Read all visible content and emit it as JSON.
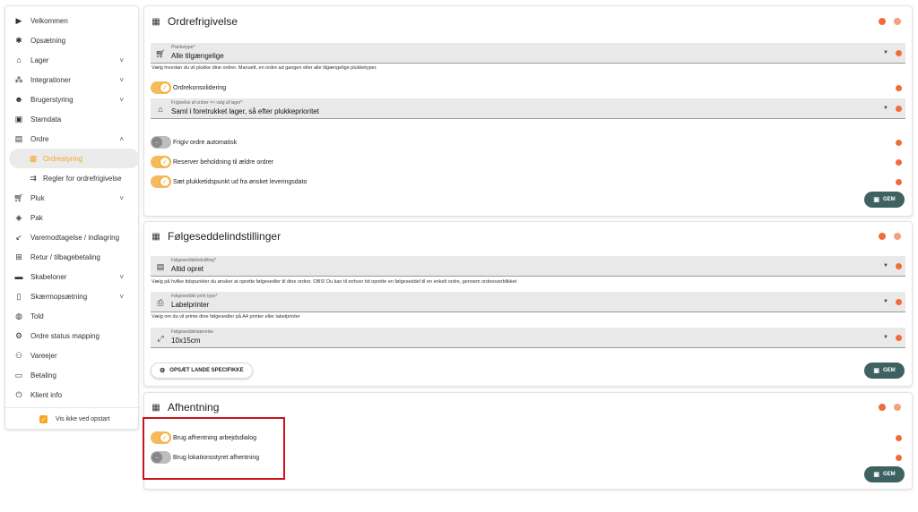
{
  "sidebar": {
    "items": [
      {
        "label": "Velkommen",
        "icon": "play-icon"
      },
      {
        "label": "Opsætning",
        "icon": "gears-icon"
      },
      {
        "label": "Lager",
        "icon": "warehouse-icon",
        "expand": "˅"
      },
      {
        "label": "Integrationer",
        "icon": "hub-icon",
        "expand": "˅"
      },
      {
        "label": "Brugerstyring",
        "icon": "users-icon",
        "expand": "˅"
      },
      {
        "label": "Stamdata",
        "icon": "data-icon"
      },
      {
        "label": "Ordre",
        "icon": "order-icon",
        "expand": "˄"
      },
      {
        "label": "Ordrestyring",
        "icon": "order-control-icon",
        "active": true
      },
      {
        "label": "Regler for ordrefrigivelse",
        "icon": "rules-icon"
      },
      {
        "label": "Pluk",
        "icon": "cart-icon",
        "expand": "˅"
      },
      {
        "label": "Pak",
        "icon": "package-icon"
      },
      {
        "label": "Varemodtagelse / indlagring",
        "icon": "arrow-in-icon"
      },
      {
        "label": "Retur / tilbagebetaling",
        "icon": "return-icon"
      },
      {
        "label": "Skabeloner",
        "icon": "template-icon",
        "expand": "˅"
      },
      {
        "label": "Skærmopsætning",
        "icon": "phone-icon",
        "expand": "˅"
      },
      {
        "label": "Told",
        "icon": "globe-icon"
      },
      {
        "label": "Ordre status mapping",
        "icon": "gear-icon"
      },
      {
        "label": "Vareejer",
        "icon": "owners-icon"
      },
      {
        "label": "Betaling",
        "icon": "payment-icon"
      },
      {
        "label": "Klient info",
        "icon": "power-icon"
      }
    ],
    "footer_label": "Vis ikke ved opstart"
  },
  "panels": {
    "release": {
      "title": "Ordrefrigivelse",
      "pick_type": {
        "label": "Plukketype*",
        "value": "Alle tilgængelige",
        "help": "Vælg hvordan du vil plukke dine ordrer. Manuelt, en ordre ad gangen eller alle tilgængelige plukketyper."
      },
      "consolidation": {
        "label": "Ordrekonsolidering",
        "on": true
      },
      "release_by": {
        "label": "Frigivelse af ordrer => valg af lager*",
        "value": "Saml i foretrukket lager, så efter plukkeprioritet"
      },
      "auto_release": {
        "label": "Frigiv ordre automatisk",
        "on": false
      },
      "reserve": {
        "label": "Reserver beholdning til ældre ordrer",
        "on": true
      },
      "pick_time": {
        "label": "Sæt plukketidspunkt ud fra ønsket leveringsdato",
        "on": true
      },
      "save_label": "GEM"
    },
    "slip": {
      "title": "Følgeseddelindstillinger",
      "setting": {
        "label": "Følgeseddelindstilling*",
        "value": "Altid opret",
        "help": "Vælg på hvilke tidspunkter du ønsker at oprette følgesedler til dine ordrer. OBS! Du kan til enhver tid oprette en følgeseddel til en enkelt ordre, gennem ordreoverblikket"
      },
      "print_type": {
        "label": "Følgeseddel print type*",
        "value": "Labelprinter",
        "help": "Vælg om du vil printe dine følgesedler på A4 printer eller labelprinter"
      },
      "size": {
        "label": "Følgeseddelstørrelse",
        "value": "10x15cm"
      },
      "country_button": "OPSÆT LANDE SPECIFIKKE",
      "save_label": "GEM"
    },
    "pickup": {
      "title": "Afhentning",
      "dialog": {
        "label": "Brug afhentning arbejdsdialog",
        "on": true
      },
      "location": {
        "label": "Brug lokationsstyret afhentning",
        "on": false
      },
      "save_label": "GEM"
    }
  },
  "colors": {
    "accent": "#f5a623",
    "save_button": "#3e6262",
    "dot": "#f26b3a",
    "highlight": "#c8141b"
  }
}
